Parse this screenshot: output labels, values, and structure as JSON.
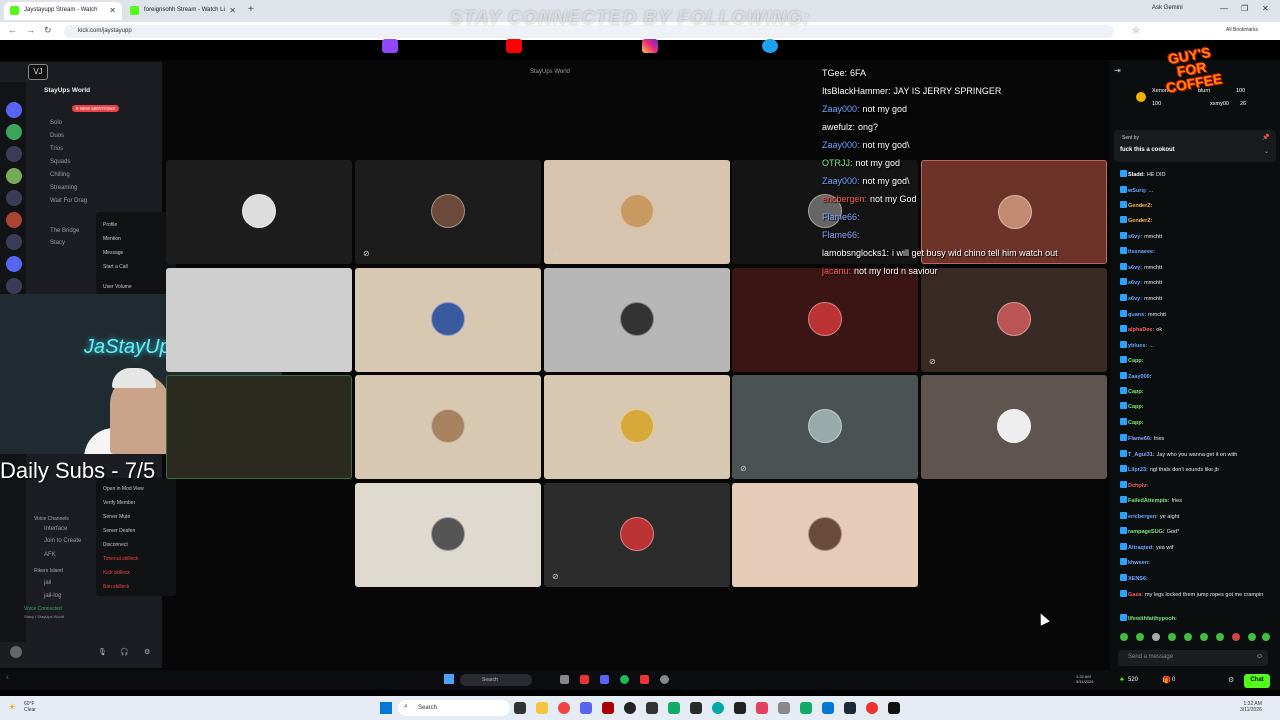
{
  "browser": {
    "tabs": [
      {
        "label": "Jaystayupp Stream - Watch"
      },
      {
        "label": "foreignsohh Stream - Watch Li"
      }
    ],
    "url": "kick.com/jaystayupp",
    "ask_gemini": "Ask Gemini",
    "all_bookmarks": "All Bookmarks"
  },
  "overlay": {
    "banner": "STAY CONNECTED BY FOLLOWING:",
    "badge_text": "VJ",
    "daily_subs": "Daily Subs - 7/5",
    "neon_sign": "JaStayUp"
  },
  "discord": {
    "server_name": "StayUps World",
    "window_title": "StayUps World",
    "new_mentions": "9 NEW MENTIONS",
    "channels": [
      "Solo",
      "Duos",
      "Trios",
      "Squads",
      "Chilling",
      "Streaming",
      "Wait For Drag",
      "The Bridge",
      "Stacy"
    ],
    "context_menu": [
      "Profile",
      "Mention",
      "Message",
      "Start a Call",
      "User Volume"
    ],
    "context_menu2": [
      "Open in Mod View",
      "Verify Member",
      "Server Mute",
      "Server Deafen",
      "Disconnect",
      "Timeout skilleck",
      "Kick skilleck",
      "Ban skilleck"
    ],
    "lower_channels": [
      "Voice Channels",
      "Interface",
      "Join to Create",
      "AFK",
      "Rikers Island",
      "jail",
      "jail-log"
    ],
    "voice_connected": "Voice Connected",
    "voice_sub": "Stacy / StayUps World"
  },
  "overlay_chat": [
    {
      "user": "TGee:",
      "text": "6FA",
      "color": "#ffffff"
    },
    {
      "user": "ItsBlackHammer:",
      "text": "JAY IS JERRY SPRINGER",
      "color": "#ffffff"
    },
    {
      "user": "Zaay000:",
      "text": "not my god",
      "color": "#6aa6ff"
    },
    {
      "user": "awefulz:",
      "text": "ong?",
      "color": "#ffffff"
    },
    {
      "user": "Zaay000:",
      "text": "not my god\\",
      "color": "#6aa6ff"
    },
    {
      "user": "OTRJJ:",
      "text": "not my god",
      "color": "#7be37b"
    },
    {
      "user": "Zaay000:",
      "text": "not my god\\",
      "color": "#6aa6ff"
    },
    {
      "user": "ericbergen:",
      "text": "not my God",
      "color": "#ff5a5a"
    },
    {
      "user": "Flame66:",
      "text": "",
      "color": "#8aa2ff"
    },
    {
      "user": "Flame66:",
      "text": "",
      "color": "#8aa2ff"
    },
    {
      "user": "lamobsnglocks1:",
      "text": "i will get busy wid chino tell him watch out",
      "color": "#ffffff"
    },
    {
      "user": "jacanu:",
      "text": "not my lord n saviour",
      "color": "#ff5a5a"
    }
  ],
  "kick_chat": {
    "pinned_label": "Sent by",
    "pinned_text": "fuck this a cookout",
    "top_users": [
      {
        "name": "Xenon",
        "value": "100"
      },
      {
        "name": "blurri",
        "value": "100"
      },
      {
        "name": "xxmy00",
        "value": "26"
      }
    ],
    "messages": [
      {
        "user": "Sladd:",
        "text": "HE DID",
        "color": "#ffffff"
      },
      {
        "user": "wSurq:",
        "text": "...",
        "color": "#6aa6ff"
      },
      {
        "user": "GenderZ:",
        "text": "",
        "color": "#ffb347"
      },
      {
        "user": "GenderZ:",
        "text": "",
        "color": "#ffb347"
      },
      {
        "user": "s6vy:",
        "text": "mmchtt",
        "color": "#6aa6ff"
      },
      {
        "user": "itssnaeee:",
        "text": "",
        "color": "#6aa6ff"
      },
      {
        "user": "s6vy:",
        "text": "mmchtt",
        "color": "#6aa6ff"
      },
      {
        "user": "s6vy:",
        "text": "mmchtt",
        "color": "#6aa6ff"
      },
      {
        "user": "s6vy:",
        "text": "mmchtt",
        "color": "#6aa6ff"
      },
      {
        "user": "quans:",
        "text": "mmchtt",
        "color": "#6aa6ff"
      },
      {
        "user": "alphaDee:",
        "text": "ok",
        "color": "#ff5a5a"
      },
      {
        "user": "yblues:",
        "text": "...",
        "color": "#6aa6ff"
      },
      {
        "user": "Capp:",
        "text": "",
        "color": "#7be37b"
      },
      {
        "user": "Zaay000:",
        "text": "",
        "color": "#6aa6ff"
      },
      {
        "user": "Capp:",
        "text": "",
        "color": "#7be37b"
      },
      {
        "user": "Capp:",
        "text": "",
        "color": "#7be37b"
      },
      {
        "user": "Capp:",
        "text": "",
        "color": "#7be37b"
      },
      {
        "user": "Flame66:",
        "text": "fries",
        "color": "#8aa2ff"
      },
      {
        "user": "T_Agui31:",
        "text": "Jay who you wanna get it on with",
        "color": "#8aa2ff"
      },
      {
        "user": "Lilpr23:",
        "text": "ngl thats don't sounds like jb",
        "color": "#6aa6ff"
      },
      {
        "user": "Dchplv:",
        "text": "",
        "color": "#ff5a5a"
      },
      {
        "user": "FailedAttempts:",
        "text": "fries",
        "color": "#7be37b"
      },
      {
        "user": "ericbergen:",
        "text": "ye aight",
        "color": "#6aa6ff"
      },
      {
        "user": "rampageSUG:",
        "text": "God*",
        "color": "#7be37b"
      },
      {
        "user": "Altraqted:",
        "text": "yea wtf",
        "color": "#6aa6ff"
      },
      {
        "user": "khween:",
        "text": "",
        "color": "#6aa6ff"
      },
      {
        "user": "XENS6:",
        "text": "",
        "color": "#6aa6ff"
      },
      {
        "user": "Gaza:",
        "text": "my legs locked them jump ropes got me crampin",
        "color": "#ff5a5a"
      },
      {
        "user": "lifewithfaithypooh:",
        "text": "",
        "color": "#7be37b"
      }
    ],
    "send_placeholder": "Send a message",
    "viewer_count": "520",
    "zero": "0",
    "chat_button": "Chat"
  },
  "stream_taskbar": {
    "search": "Search",
    "time": "1:32 AM",
    "date": "3/11/2026"
  },
  "taskbar": {
    "weather_temp": "60°F",
    "weather_desc": "Clear",
    "search": "Search",
    "time": "1:32 AM",
    "date": "3/11/2026"
  },
  "colors": {
    "kick_green": "#53fc18",
    "discord_bg": "#1c1d22",
    "chat_bg": "#0b0e0f"
  }
}
